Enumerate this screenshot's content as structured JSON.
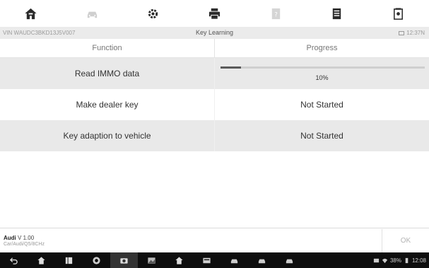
{
  "toolbar": {
    "icons": [
      "home-icon",
      "car-icon",
      "gear-icon",
      "printer-icon",
      "help-icon",
      "data-logging-icon",
      "screenshot-icon"
    ]
  },
  "infobar": {
    "vin": "VIN WAUDC3BKD13J5V007",
    "title": "Key Learning",
    "time": "12:37N"
  },
  "table": {
    "headers": {
      "function": "Function",
      "progress": "Progress"
    },
    "rows": [
      {
        "function": "Read IMMO data",
        "progress_text": "10%",
        "progress_value": 0.1
      },
      {
        "function": "Make dealer key",
        "progress_text": "Not Started"
      },
      {
        "function": "Key adaption to vehicle",
        "progress_text": "Not Started"
      }
    ]
  },
  "footer": {
    "make": "Audi",
    "version": "V 1.00",
    "path": "Car/Audi/Q5/8CHz",
    "ok_label": "OK"
  },
  "navbar": {
    "icons": [
      "back-icon",
      "home-icon",
      "recent-apps-icon",
      "chrome-icon",
      "camera-icon",
      "gallery-icon",
      "home-icon",
      "vci-icon",
      "car-icon",
      "car-icon",
      "car-icon"
    ],
    "status_time": "12:08",
    "battery": "38%"
  },
  "colors": {
    "progress_fill": "#5a5a5a",
    "progress_track": "#cfcfcf",
    "row_alt": "#e9e9e9"
  }
}
